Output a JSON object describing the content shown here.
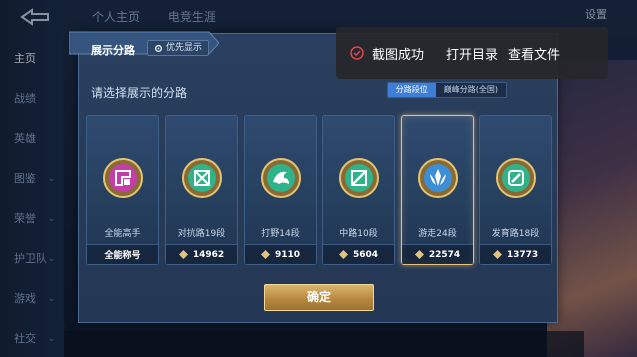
{
  "top_tabs": [
    "个人主页",
    "电竞生涯"
  ],
  "top_right": "设置",
  "sidebar": {
    "items": [
      {
        "label": "主页",
        "active": true
      },
      {
        "label": "战绩",
        "active": false
      },
      {
        "label": "英雄",
        "active": false
      },
      {
        "label": "图鉴",
        "active": false
      },
      {
        "label": "荣誉",
        "active": false
      },
      {
        "label": "护卫队",
        "active": false
      },
      {
        "label": "游戏",
        "active": false
      },
      {
        "label": "社交",
        "active": false
      }
    ]
  },
  "dialog": {
    "title": "展示分路",
    "priority_label": "优先显示",
    "prompt": "请选择展示的分路",
    "segments": [
      {
        "label": "分路段位",
        "active": true
      },
      {
        "label": "巅峰分路(全国)",
        "active": false
      }
    ],
    "cards": [
      {
        "name": "全能高手",
        "footer": "全能称号",
        "badge_color": "#c43ea9",
        "selected": false
      },
      {
        "name": "对抗路19段",
        "footer": "14962",
        "badge_color": "#2fb38a",
        "selected": false
      },
      {
        "name": "打野14段",
        "footer": "9110",
        "badge_color": "#2fb38a",
        "selected": false
      },
      {
        "name": "中路10段",
        "footer": "5604",
        "badge_color": "#2fb38a",
        "selected": false
      },
      {
        "name": "游走24段",
        "footer": "22574",
        "badge_color": "#3c8fd6",
        "selected": true
      },
      {
        "name": "发育路18段",
        "footer": "13773",
        "badge_color": "#2fb38a",
        "selected": false
      }
    ],
    "confirm_label": "确定"
  },
  "toast": {
    "message": "截图成功",
    "open_folder": "打开目录",
    "view_file": "查看文件"
  },
  "colors": {
    "accent_blue": "#3d7ed6",
    "gold": "#e5c27a",
    "toast_bg": "#26262a"
  }
}
